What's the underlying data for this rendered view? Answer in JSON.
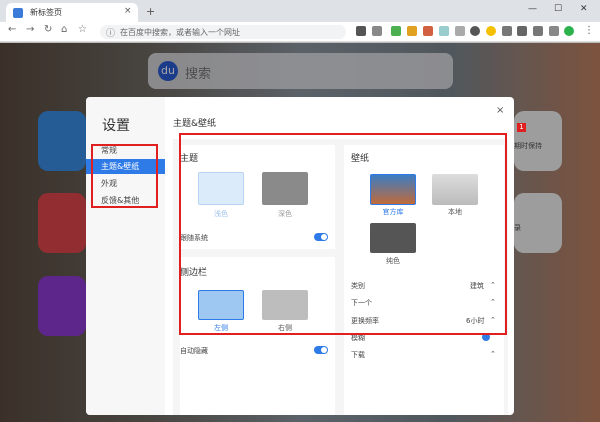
{
  "browser": {
    "tab_title": "新标签页",
    "tab_close": "×",
    "new_tab": "+",
    "address_placeholder": "在百度中搜索，或者输入一个网址",
    "nav": {
      "back": "←",
      "forward": "→",
      "reload": "↻",
      "home": "⌂",
      "star": "☆",
      "info": "ⓘ"
    },
    "window": {
      "minimize": "—",
      "maximize": "☐",
      "close": "✕"
    }
  },
  "page": {
    "search_placeholder": "搜索",
    "search_logo": "du",
    "tile_badge": "1",
    "tile_text_1": "期时保持",
    "tile_text_2": "录"
  },
  "settings": {
    "title": "设置",
    "close": "×",
    "nav": [
      "常规",
      "主题&壁纸",
      "外观",
      "反馈&其他"
    ],
    "active_index": 1,
    "section_title": "主题&壁纸",
    "theme": {
      "title": "主题",
      "options": [
        "浅色",
        "深色"
      ],
      "follow_system_label": "跟随系统",
      "follow_system": true
    },
    "sidebar_section": {
      "title": "侧边栏",
      "options": [
        "左侧",
        "右侧"
      ],
      "auto_hide_label": "自动隐藏",
      "auto_hide": true
    },
    "wallpaper": {
      "title": "壁纸",
      "options": [
        "官方库",
        "本地",
        "纯色"
      ],
      "rows": [
        {
          "label": "类别",
          "value": "建筑",
          "arrow": "⌃"
        },
        {
          "label": "下一个",
          "value": "",
          "arrow": "⌃"
        },
        {
          "label": "更换频率",
          "value": "6小时",
          "arrow": "⌃"
        },
        {
          "label": "模糊",
          "value": "",
          "arrow": ""
        },
        {
          "label": "下载",
          "value": "",
          "arrow": "⌃"
        }
      ]
    }
  },
  "colors": {
    "accent": "#2e7ae6",
    "highlight_border": "#e02020"
  }
}
